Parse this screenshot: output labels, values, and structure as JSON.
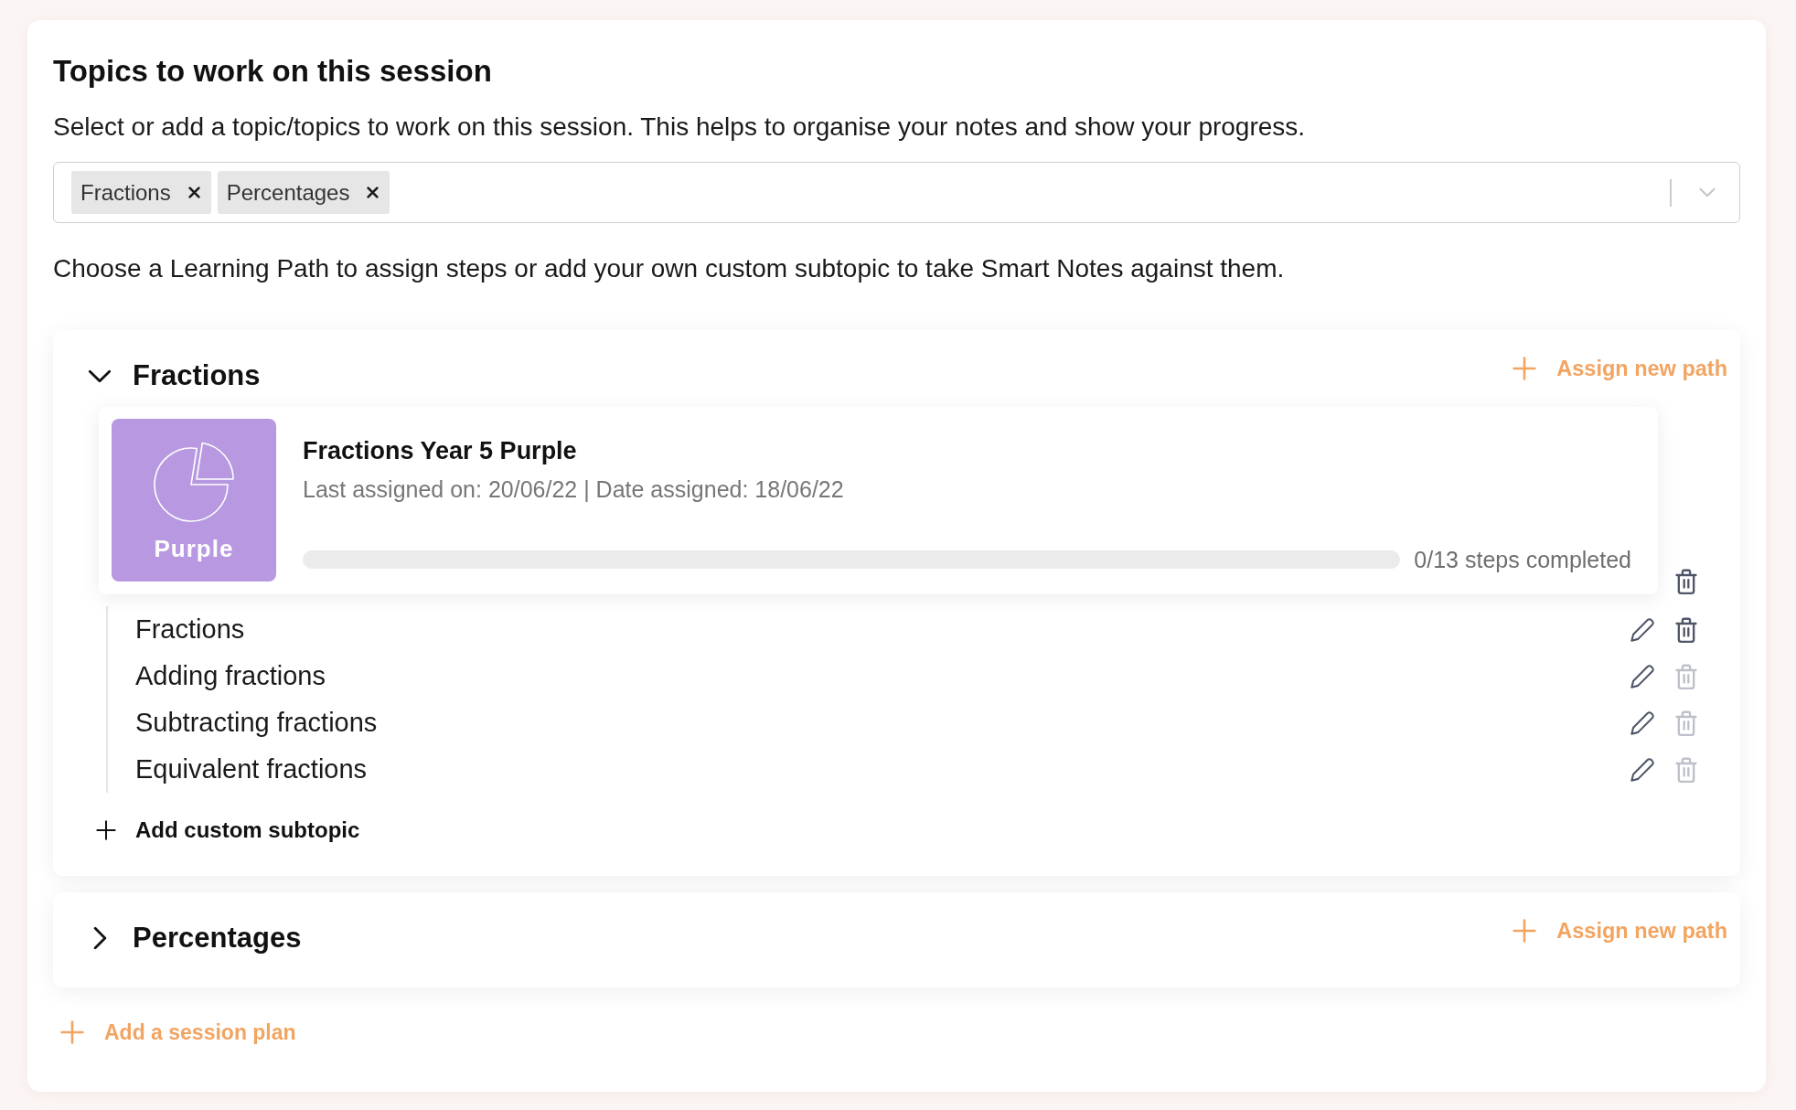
{
  "section": {
    "title": "Topics to work on this session",
    "description": "Select or add a topic/topics to work on this session. This helps to organise your notes and show your progress."
  },
  "topic_select": {
    "tags": [
      {
        "label": "Fractions"
      },
      {
        "label": "Percentages"
      }
    ]
  },
  "instructions": "Choose a Learning Path to assign steps or add your own custom subtopic to take Smart Notes against them.",
  "topics": [
    {
      "name": "Fractions",
      "expanded": true,
      "assign_label": "Assign new path",
      "paths": [
        {
          "badge": "Purple",
          "color": "#b899e1",
          "title": "Fractions Year 5 Purple",
          "meta": "Last assigned on: 20/06/22 | Date assigned: 18/06/22",
          "progress_text": "0/13 steps completed",
          "subtopics": [
            {
              "name": "Fractions",
              "delete_disabled": false
            },
            {
              "name": "Adding fractions",
              "delete_disabled": true
            },
            {
              "name": "Subtracting fractions",
              "delete_disabled": true
            },
            {
              "name": "Equivalent fractions",
              "delete_disabled": true
            }
          ]
        }
      ],
      "add_subtopic_label": "Add custom subtopic"
    },
    {
      "name": "Percentages",
      "expanded": false,
      "assign_label": "Assign new path"
    }
  ],
  "add_plan_label": "Add a session plan"
}
